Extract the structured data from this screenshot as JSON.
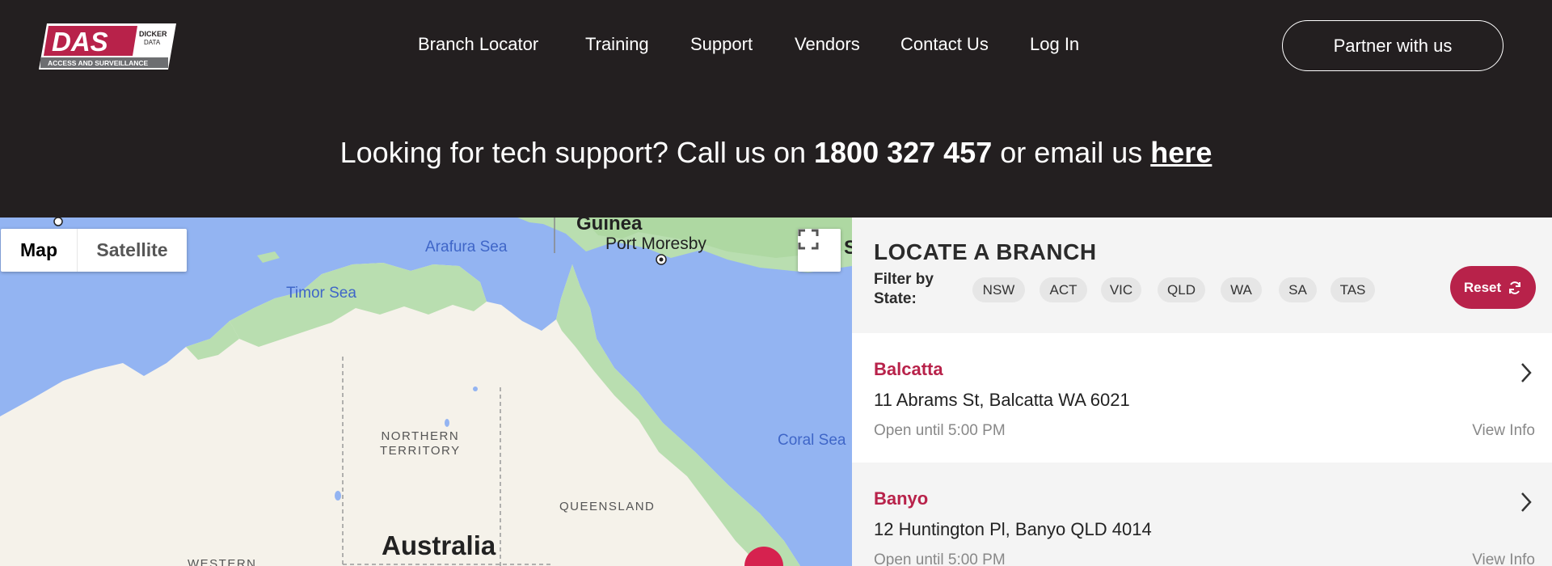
{
  "logo": {
    "wordmark": "DAS",
    "badge_line1": "DICKER",
    "badge_line2": "DATA",
    "tagline": "ACCESS AND SURVEILLANCE"
  },
  "nav": {
    "items": [
      "Branch Locator",
      "Training",
      "Support",
      "Vendors",
      "Contact Us",
      "Log In"
    ],
    "cta": "Partner with us"
  },
  "support": {
    "prefix": "Looking for tech support? Call us on ",
    "phone": "1800 327 457",
    "middle": " or email us ",
    "link": "here"
  },
  "map": {
    "toggle": {
      "map": "Map",
      "satellite": "Satellite"
    },
    "labels": {
      "guinea": "Guinea",
      "port_moresby": "Port Moresby",
      "arafura": "Arafura Sea",
      "timor": "Timor Sea",
      "coral": "Coral Sea",
      "nt_line1": "NORTHERN",
      "nt_line2": "TERRITORY",
      "qld": "QUEENSLAND",
      "australia": "Australia",
      "western": "WESTERN",
      "edge": "S"
    },
    "icons": {
      "fullscreen": "fullscreen-icon"
    }
  },
  "panel": {
    "title": "LOCATE A BRANCH",
    "filter_label_line1": "Filter by",
    "filter_label_line2": "State:",
    "states": [
      "NSW",
      "ACT",
      "VIC",
      "QLD",
      "WA",
      "SA",
      "TAS"
    ],
    "reset_label": "Reset",
    "branches": [
      {
        "name": "Balcatta",
        "address": "11 Abrams St, Balcatta WA 6021",
        "hours": "Open until 5:00 PM",
        "view": "View Info"
      },
      {
        "name": "Banyo",
        "address": "12 Huntington Pl, Banyo QLD 4014",
        "hours": "Open until 5:00 PM",
        "view": "View Info"
      }
    ]
  },
  "colors": {
    "brand": "#b8224a",
    "header_bg": "#231f20",
    "map_water": "#93b4f2",
    "map_land": "#f5f2ea",
    "map_green": "#b9deb0"
  }
}
